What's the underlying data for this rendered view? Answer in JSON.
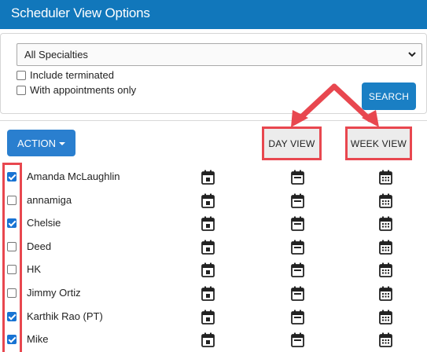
{
  "header": {
    "title": "Scheduler View Options"
  },
  "filters": {
    "specialty_select": "All Specialties",
    "include_terminated": "Include terminated",
    "with_appointments_only": "With appointments only",
    "search_label": "SEARCH"
  },
  "toolbar": {
    "action_label": "ACTION",
    "day_view_label": "DAY VIEW",
    "week_view_label": "WEEK VIEW"
  },
  "rows": [
    {
      "name": "Amanda McLaughlin",
      "checked": true
    },
    {
      "name": "annamiga",
      "checked": false
    },
    {
      "name": "Chelsie",
      "checked": true
    },
    {
      "name": "Deed",
      "checked": false
    },
    {
      "name": "HK",
      "checked": false
    },
    {
      "name": "Jimmy Ortiz",
      "checked": false
    },
    {
      "name": "Karthik Rao (PT)",
      "checked": true
    },
    {
      "name": "Mike",
      "checked": true
    }
  ],
  "icons": {
    "col1": "calendar-day-icon",
    "col2": "calendar-blank-icon",
    "col3": "calendar-grid-icon"
  },
  "colors": {
    "header_bg": "#1177bb",
    "button_bg": "#2a7fcf",
    "highlight": "#e8474f",
    "checkbox_checked": "#1873d3"
  }
}
